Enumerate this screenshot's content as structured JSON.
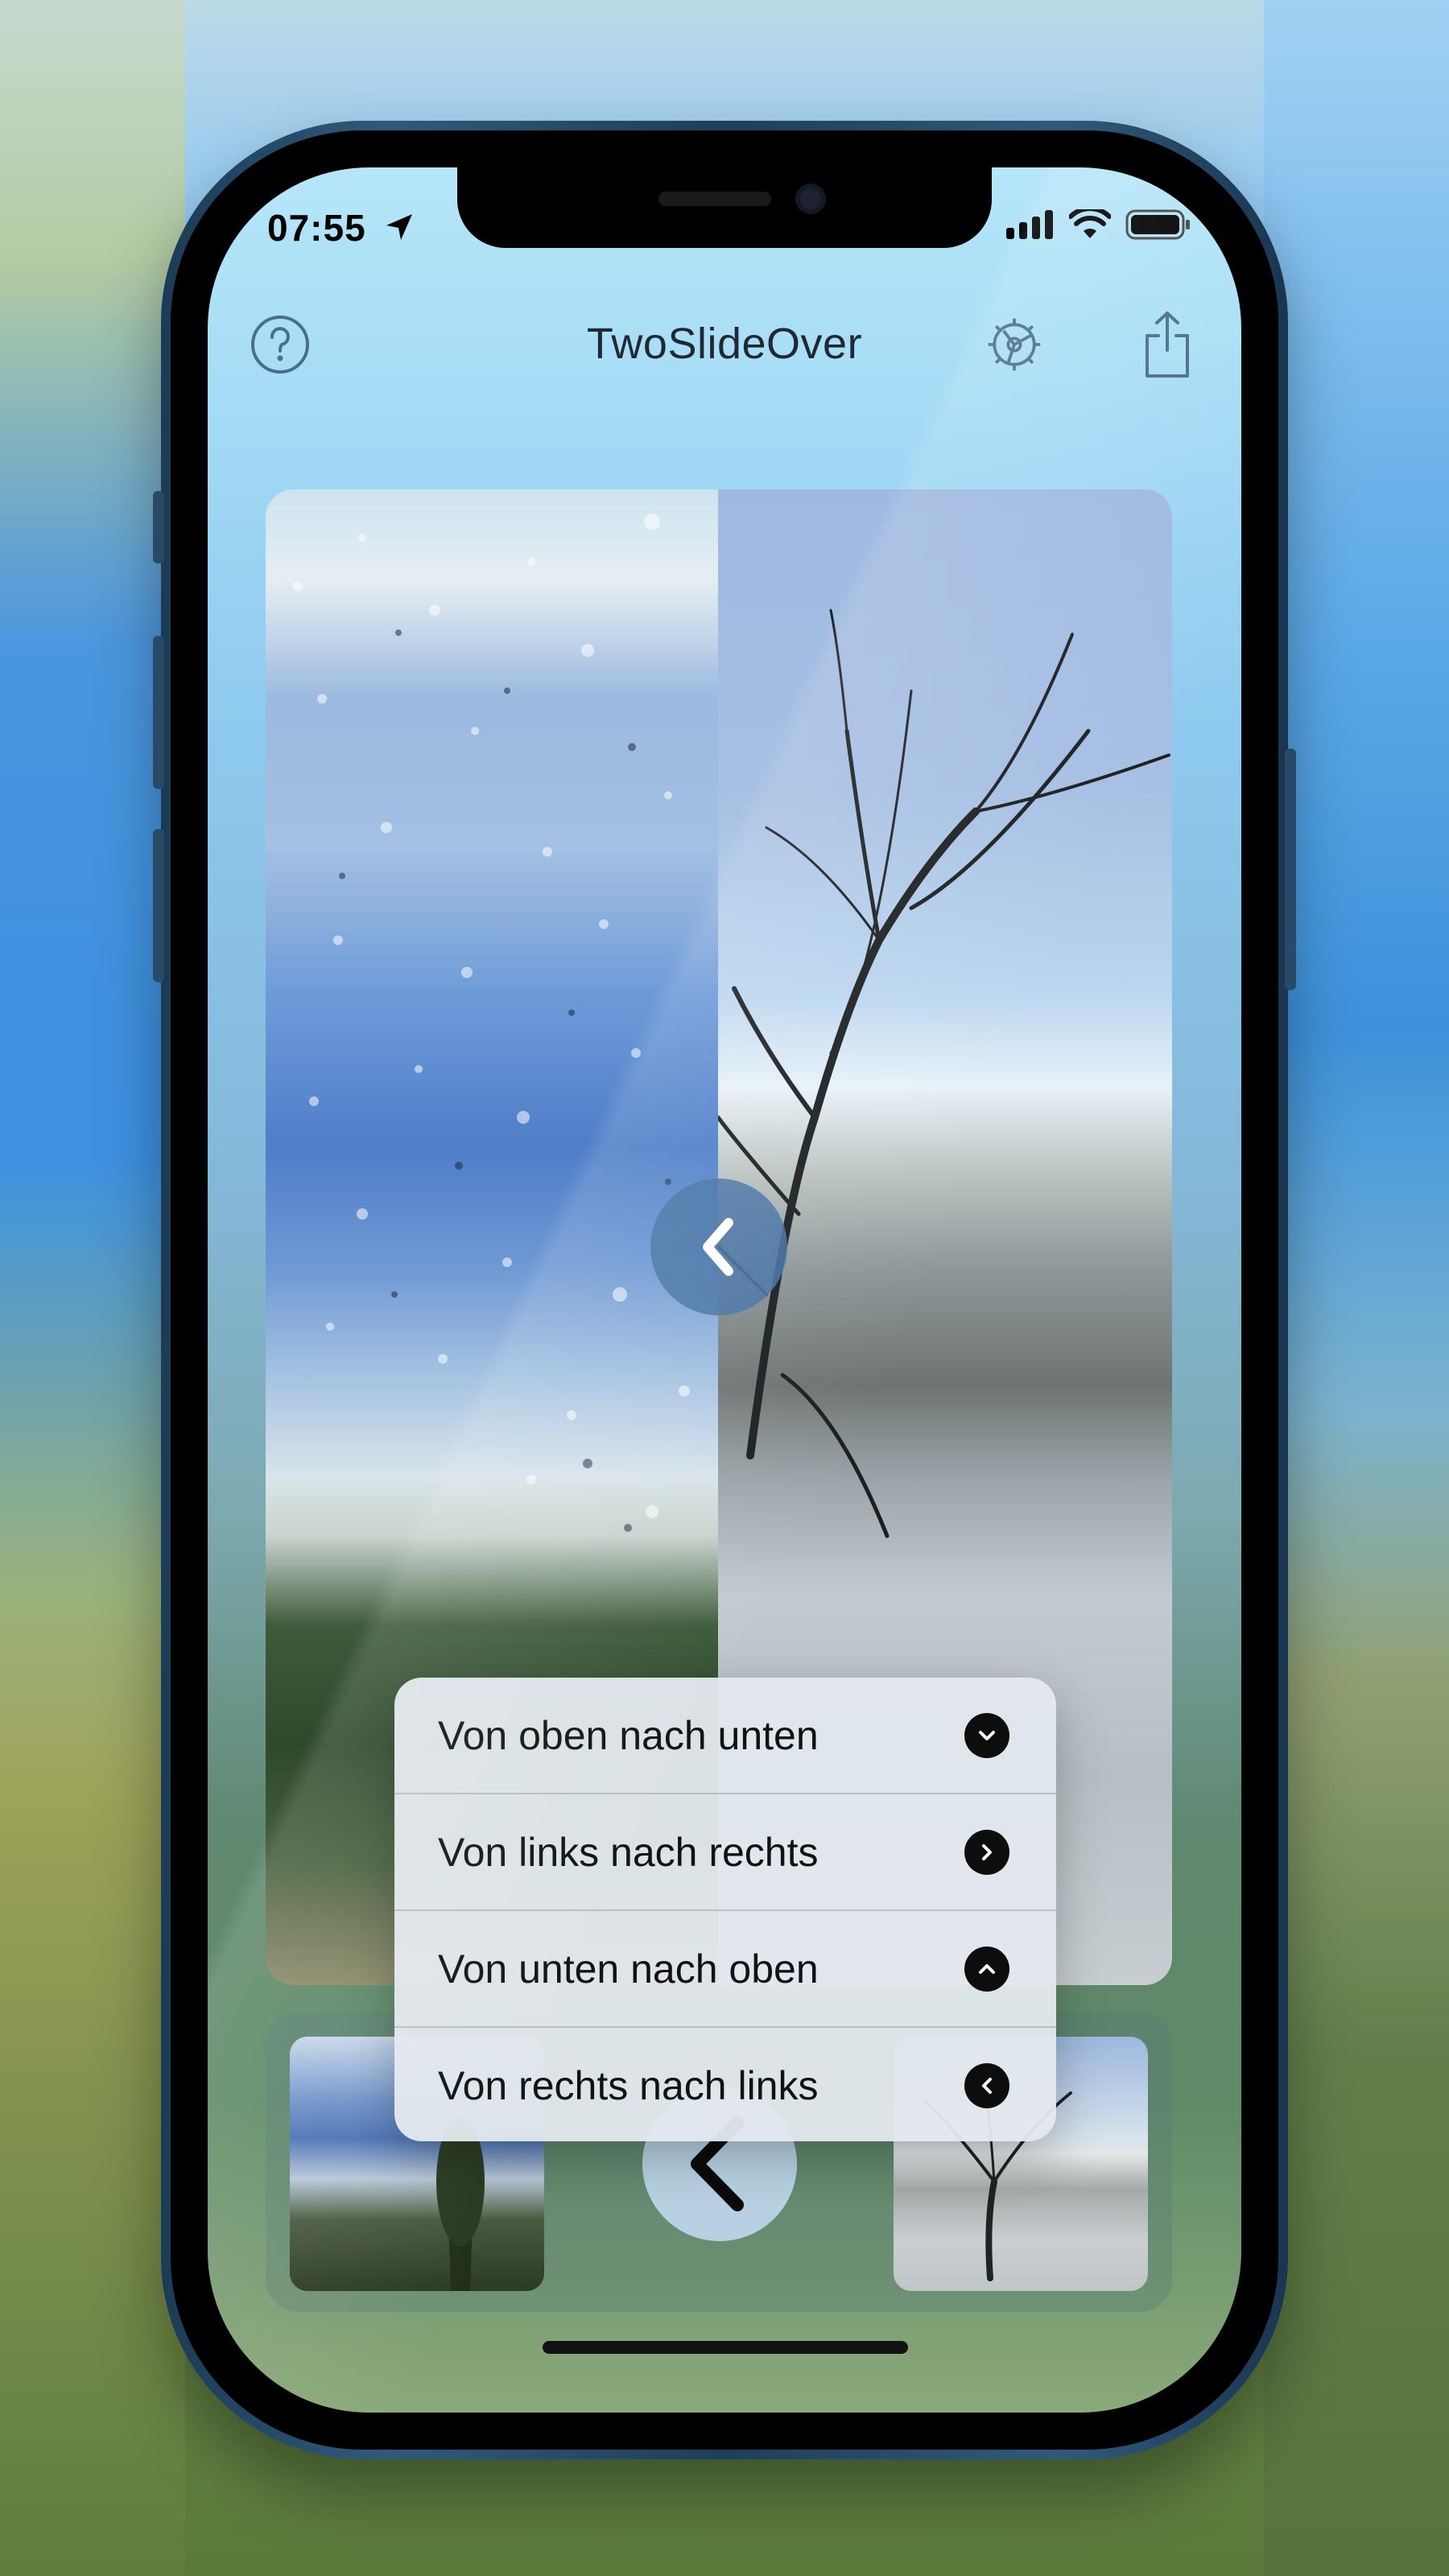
{
  "status_bar": {
    "time": "07:55"
  },
  "toolbar": {
    "title": "TwoSlideOver",
    "help_icon": "help-circle-icon",
    "settings_icon": "gear-icon",
    "share_icon": "share-icon"
  },
  "compare": {
    "handle_icon": "chevron-left-icon",
    "split_fraction": 0.5
  },
  "thumbnails": {
    "back_icon": "chevron-left-icon"
  },
  "menu": {
    "items": [
      {
        "label": "Von oben nach unten",
        "icon": "chevron-down-circle-icon"
      },
      {
        "label": "Von links nach rechts",
        "icon": "chevron-right-circle-icon"
      },
      {
        "label": "Von unten nach oben",
        "icon": "chevron-up-circle-icon"
      },
      {
        "label": "Von rechts nach links",
        "icon": "chevron-left-circle-icon"
      }
    ]
  },
  "colors": {
    "toolbar_icon": "#4a6e8e",
    "handle": "#4673a5"
  }
}
